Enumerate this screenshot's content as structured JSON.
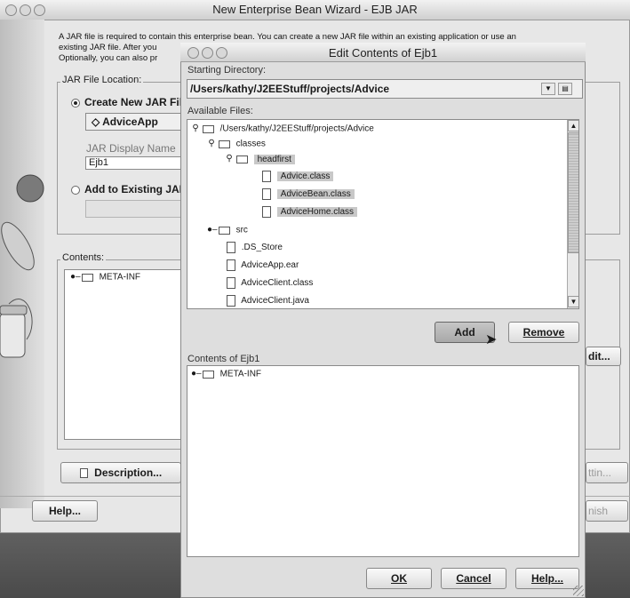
{
  "bg_window": {
    "title": "New Enterprise Bean Wizard - EJB JAR",
    "intro_line1": "A JAR file is required to contain this enterprise bean. You can create a new JAR file within an existing application or use an",
    "intro_line2": "existing JAR file. After you",
    "intro_line3": "Optionally, you can also pr",
    "jar_location_legend": "JAR File Location:",
    "create_new_label": "Create New JAR Fil",
    "app_combo": "AdviceApp",
    "jar_display_name_label": "JAR Display Name",
    "jar_display_name_value": "Ejb1",
    "add_existing_label": "Add to Existing JAR",
    "contents_legend": "Contents:",
    "contents_item": "META-INF",
    "description_button": "Description...",
    "edit_button": "dit...",
    "settings_button": "ttin...",
    "help_button": "Help...",
    "finish_button": "nish"
  },
  "dialog": {
    "title": "Edit Contents of Ejb1",
    "starting_directory_label": "Starting Directory:",
    "starting_directory_value": "/Users/kathy/J2EEStuff/projects/Advice",
    "available_files_label": "Available Files:",
    "tree": [
      {
        "label": "/Users/kathy/J2EEStuff/projects/Advice",
        "type": "folder",
        "expanded": true
      },
      {
        "label": "classes",
        "type": "folder",
        "expanded": true
      },
      {
        "label": "headfirst",
        "type": "folder",
        "expanded": true
      },
      {
        "label": "Advice.class",
        "type": "file"
      },
      {
        "label": "AdviceBean.class",
        "type": "file"
      },
      {
        "label": "AdviceHome.class",
        "type": "file"
      },
      {
        "label": "src",
        "type": "folder",
        "expanded": false
      },
      {
        "label": ".DS_Store",
        "type": "file"
      },
      {
        "label": "AdviceApp.ear",
        "type": "file"
      },
      {
        "label": "AdviceClient.class",
        "type": "file"
      },
      {
        "label": "AdviceClient.java",
        "type": "file"
      }
    ],
    "add_button": "Add",
    "remove_button": "Remove",
    "contents_label": "Contents of Ejb1",
    "contents_item": "META-INF",
    "ok_button": "OK",
    "cancel_button": "Cancel",
    "help_button": "Help..."
  },
  "colors": {
    "selection": "#c8c8c8",
    "default_button": "#b4b4b4"
  }
}
